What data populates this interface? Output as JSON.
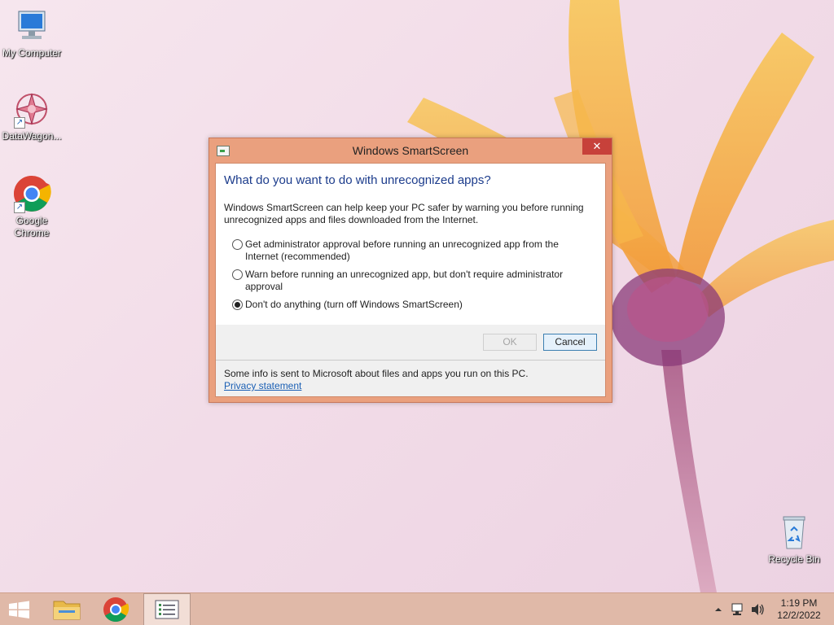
{
  "desktop": {
    "icons": [
      {
        "label": "My Computer"
      },
      {
        "label": "DataWagon..."
      },
      {
        "label": "Google Chrome"
      },
      {
        "label": "Recycle Bin"
      }
    ]
  },
  "dialog": {
    "title": "Windows SmartScreen",
    "close_label": "✕",
    "heading": "What do you want to do with unrecognized apps?",
    "description": "Windows SmartScreen can help keep your PC safer by warning you before running unrecognized apps and files downloaded from the Internet.",
    "options": [
      {
        "label": "Get administrator approval before running an unrecognized app from the Internet (recommended)",
        "checked": false
      },
      {
        "label": "Warn before running an unrecognized app, but don't require administrator approval",
        "checked": false
      },
      {
        "label": "Don't do anything (turn off Windows SmartScreen)",
        "checked": true
      }
    ],
    "ok_label": "OK",
    "cancel_label": "Cancel",
    "footer_text": "Some info is sent to Microsoft about files and apps you run on this PC.",
    "privacy_link": "Privacy statement"
  },
  "taskbar": {
    "items": [
      "start-button",
      "file-explorer",
      "google-chrome",
      "active-window"
    ],
    "clock_time": "1:19 PM",
    "clock_date": "12/2/2022",
    "tray_icons": [
      "chevron-up-icon",
      "network-icon",
      "speaker-icon"
    ]
  },
  "colors": {
    "accent": "#eaa07e",
    "close": "#c7413a",
    "heading": "#1c3c8c",
    "link": "#1a5fb4"
  }
}
